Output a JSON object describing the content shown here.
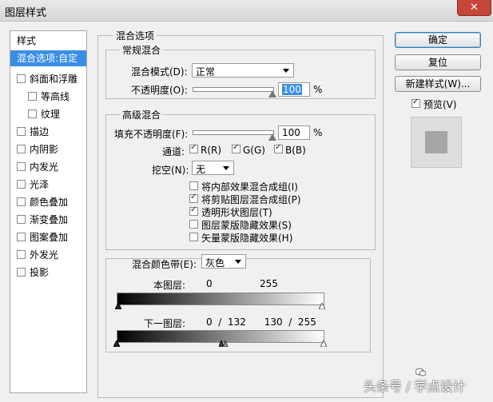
{
  "window": {
    "title": "图层样式",
    "close_label": "✕"
  },
  "sidebar": {
    "header": "样式",
    "items": [
      {
        "label": "混合选项:自定",
        "selected": true
      },
      {
        "label": "斜面和浮雕",
        "checked": false
      },
      {
        "label": "等高线",
        "checked": false
      },
      {
        "label": "纹理",
        "checked": false
      },
      {
        "label": "描边",
        "checked": false
      },
      {
        "label": "内阴影",
        "checked": false
      },
      {
        "label": "内发光",
        "checked": false
      },
      {
        "label": "光泽",
        "checked": false
      },
      {
        "label": "颜色叠加",
        "checked": false
      },
      {
        "label": "渐变叠加",
        "checked": false
      },
      {
        "label": "图案叠加",
        "checked": false
      },
      {
        "label": "外发光",
        "checked": false
      },
      {
        "label": "投影",
        "checked": false
      }
    ]
  },
  "blend_options": {
    "title": "混合选项",
    "general": {
      "title": "常规混合",
      "mode_label": "混合模式(D):",
      "mode_value": "正常",
      "opacity_label": "不透明度(O):",
      "opacity_value": "100",
      "opacity_unit": "%",
      "opacity_fraction": 1.0
    },
    "advanced": {
      "title": "高级混合",
      "fill_label": "填充不透明度(F):",
      "fill_value": "100",
      "fill_unit": "%",
      "fill_fraction": 1.0,
      "channels_label": "通道:",
      "channel_r": "R(R)",
      "channel_g": "G(G)",
      "channel_b": "B(B)",
      "knockout_label": "挖空(N):",
      "knockout_value": "无",
      "options": [
        {
          "label": "将内部效果混合成组(I)",
          "checked": false
        },
        {
          "label": "将剪贴图层混合成组(P)",
          "checked": true
        },
        {
          "label": "透明形状图层(T)",
          "checked": true
        },
        {
          "label": "图层蒙版隐藏效果(S)",
          "checked": false
        },
        {
          "label": "矢量蒙版隐藏效果(H)",
          "checked": false
        }
      ]
    },
    "blend_if": {
      "label": "混合颜色带(E):",
      "value": "灰色",
      "this_layer_label": "本图层:",
      "this_layer_low": "0",
      "this_layer_high": "255",
      "underlying_label": "下一图层:",
      "underlying_values": "0  /  132      130  /  255",
      "underlying_split_low": 132,
      "underlying_split_high": 130
    }
  },
  "buttons": {
    "ok": "确定",
    "reset": "复位",
    "new_style": "新建样式(W)...",
    "preview_label": "预览(V)",
    "preview_checked": true
  },
  "watermark": {
    "text": "头条号 / 学点设计"
  }
}
